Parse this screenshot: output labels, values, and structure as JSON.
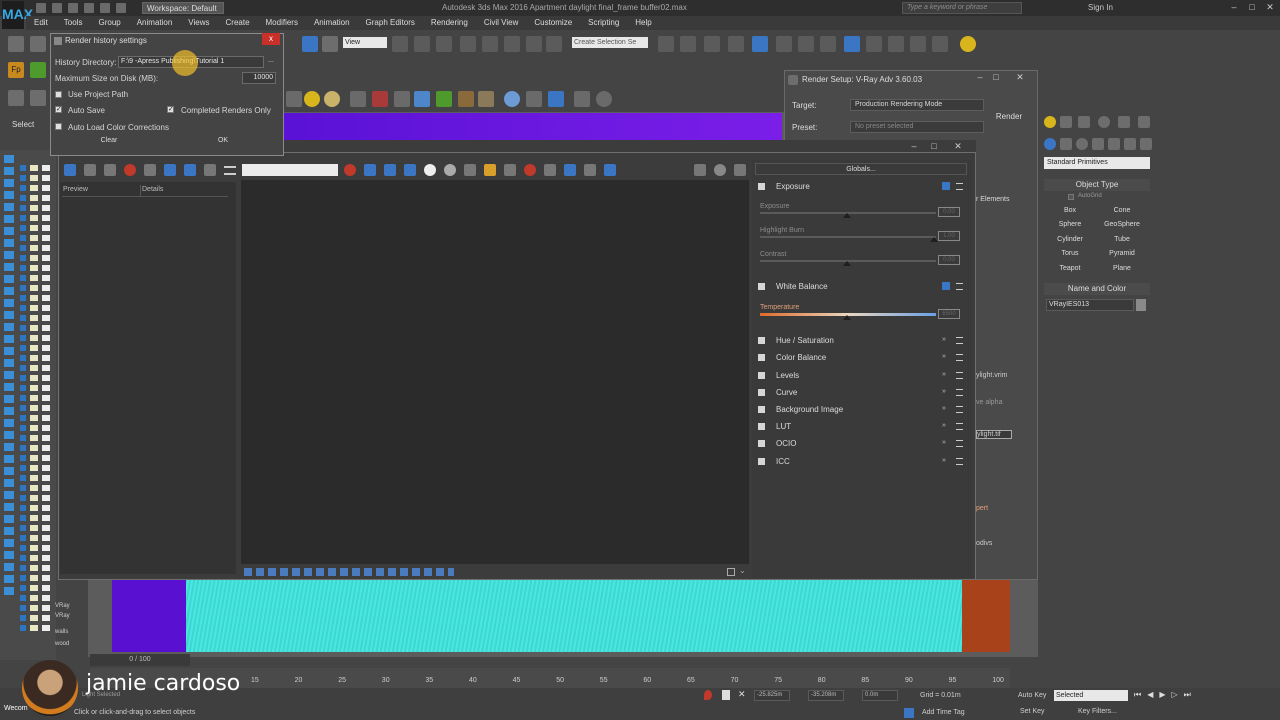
{
  "app": {
    "logo": "MAX",
    "workspace": "Workspace: Default",
    "title": "Autodesk 3ds Max 2016    Apartment daylight final_frame buffer02.max",
    "search_placeholder": "Type a keyword or phrase",
    "sign_in": "Sign In"
  },
  "menu": [
    "Edit",
    "Tools",
    "Group",
    "Animation",
    "Views",
    "Create",
    "Modifiers",
    "Animation",
    "Graph Editors",
    "Rendering",
    "Civil View",
    "Customize",
    "Scripting",
    "Help"
  ],
  "toolbar": {
    "view_dropdown": "View",
    "selection_set": "Create Selection Se",
    "select_label": "Select",
    "fp_label": "Fp"
  },
  "render_history_dialog": {
    "title": "Render history settings",
    "history_dir_label": "History Directory:",
    "history_dir_value": "F:\\9 -Apress Publishing\\Tutorial 1",
    "browse_label": "...",
    "max_size_label": "Maximum Size on Disk (MB):",
    "max_size_value": "10000",
    "use_project_path": {
      "label": "Use Project Path",
      "checked": false
    },
    "auto_save": {
      "label": "Auto Save",
      "checked": true
    },
    "completed_only": {
      "label": "Completed Renders Only",
      "checked": true
    },
    "auto_load_cc": {
      "label": "Auto Load Color Corrections",
      "checked": false
    },
    "clear_label": "Clear",
    "ok_label": "OK",
    "close_label": "x"
  },
  "render_setup": {
    "title": "Render Setup: V-Ray Adv 3.60.03",
    "target_label": "Target:",
    "target_value": "Production Rendering Mode",
    "preset_label": "Preset:",
    "preset_value": "No preset selected",
    "render_label": "Render",
    "elements_label": "r Elements",
    "partial_1": "ylight.vrim",
    "partial_2": "ve alpha",
    "partial_3": "ylight.tif",
    "partial_4": "pert",
    "partial_5": "odivs"
  },
  "vfb": {
    "history_columns": [
      "Preview",
      "Details"
    ],
    "globals_label": "Globals...",
    "corrections": [
      {
        "label": "Exposure",
        "enabled": true
      },
      {
        "label": "White Balance",
        "enabled": true
      },
      {
        "label": "Hue / Saturation",
        "enabled": false
      },
      {
        "label": "Color Balance",
        "enabled": false
      },
      {
        "label": "Levels",
        "enabled": false
      },
      {
        "label": "Curve",
        "enabled": false
      },
      {
        "label": "Background Image",
        "enabled": false
      },
      {
        "label": "LUT",
        "enabled": false
      },
      {
        "label": "OCIO",
        "enabled": false
      },
      {
        "label": "ICC",
        "enabled": false
      }
    ],
    "exposure_sliders": [
      {
        "label": "Exposure",
        "value": "0.00",
        "level": 0.5
      },
      {
        "label": "Highlight Burn",
        "value": "1.00",
        "level": 1.0
      },
      {
        "label": "Contrast",
        "value": "0.00",
        "level": 0.5
      }
    ],
    "temperature": {
      "label": "Temperature",
      "value": "6500",
      "level": 0.5
    }
  },
  "command_panel": {
    "category": "Standard Primitives",
    "object_type_title": "Object Type",
    "autogrid_label": "AutoGrid",
    "objects": [
      "Box",
      "Cone",
      "Sphere",
      "GeoSphere",
      "Cylinder",
      "Tube",
      "Torus",
      "Pyramid",
      "Teapot",
      "Plane"
    ],
    "name_color_title": "Name and Color",
    "object_name": "VRayIES013"
  },
  "explorer_labels": [
    "VRay",
    "VRay",
    "walls",
    "wood"
  ],
  "timeline": {
    "position": "0 / 100",
    "ticks": [
      "15",
      "20",
      "25",
      "30",
      "35",
      "40",
      "45",
      "50",
      "55",
      "60",
      "65",
      "70",
      "75",
      "80",
      "85",
      "90",
      "95",
      "100"
    ]
  },
  "status": {
    "selection": "Light Selected",
    "prompt": "Click or click-and-drag to select objects",
    "x": "-25.825m",
    "y": "-35.208m",
    "z": "0.0m",
    "grid": "Grid = 0.01m",
    "add_time_tag": "Add Time Tag",
    "auto_key": "Auto Key",
    "set_key": "Set Key",
    "selected_dropdown": "Selected",
    "key_filters": "Key Filters..."
  },
  "watermark": {
    "author": "jamie cardoso",
    "short": "Wecom"
  },
  "colors": {
    "viewport_purple": "#6a18e0",
    "viewport_cyan": "#42dfd8",
    "accent_blue": "#3a76c4",
    "close_red": "#c8302a"
  }
}
